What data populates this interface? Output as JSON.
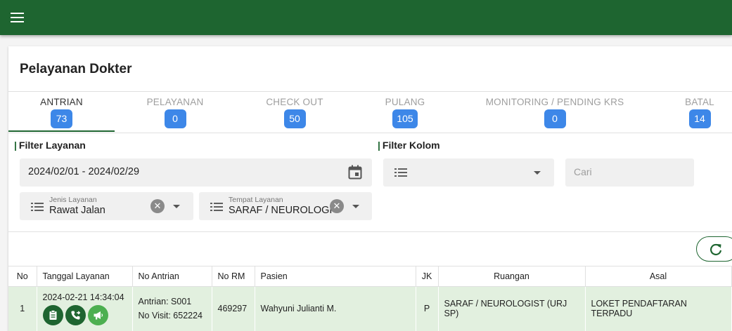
{
  "header": {
    "menu_icon": "hamburger-menu-icon",
    "color": "#1e6530"
  },
  "page": {
    "title": "Pelayanan Dokter"
  },
  "tabs": [
    {
      "label": "ANTRIAN",
      "count": "73",
      "active": true
    },
    {
      "label": "PELAYANAN",
      "count": "0",
      "active": false
    },
    {
      "label": "CHECK OUT",
      "count": "50",
      "active": false
    },
    {
      "label": "PULANG",
      "count": "105",
      "active": false
    },
    {
      "label": "MONITORING / PENDING KRS",
      "count": "0",
      "active": false
    },
    {
      "label": "BATAL",
      "count": "14",
      "active": false
    }
  ],
  "filter_layanan": {
    "title": "Filter Layanan",
    "date_range": "2024/02/01 - 2024/02/29",
    "jenis_label": "Jenis Layanan",
    "jenis_value": "Rawat Jalan",
    "tempat_label": "Tempat Layanan",
    "tempat_value": "SARAF / NEUROLOGI"
  },
  "filter_kolom": {
    "title": "Filter Kolom",
    "column_value": "",
    "search_placeholder": "Cari"
  },
  "table": {
    "headers": [
      "No",
      "Tanggal Layanan",
      "No Antrian",
      "No RM",
      "Pasien",
      "JK",
      "Ruangan",
      "Asal"
    ],
    "rows": [
      {
        "no": "1",
        "tanggal": "2024-02-21 14:34:04",
        "antrian": "Antrian: S001",
        "visit": "No Visit: 652224",
        "rm": "469297",
        "pasien": "Wahyuni Julianti M.",
        "jk": "P",
        "ruangan": "SARAF / NEUROLOGIST (URJ SP)",
        "asal": "LOKET PENDAFTARAN TERPADU"
      }
    ]
  }
}
